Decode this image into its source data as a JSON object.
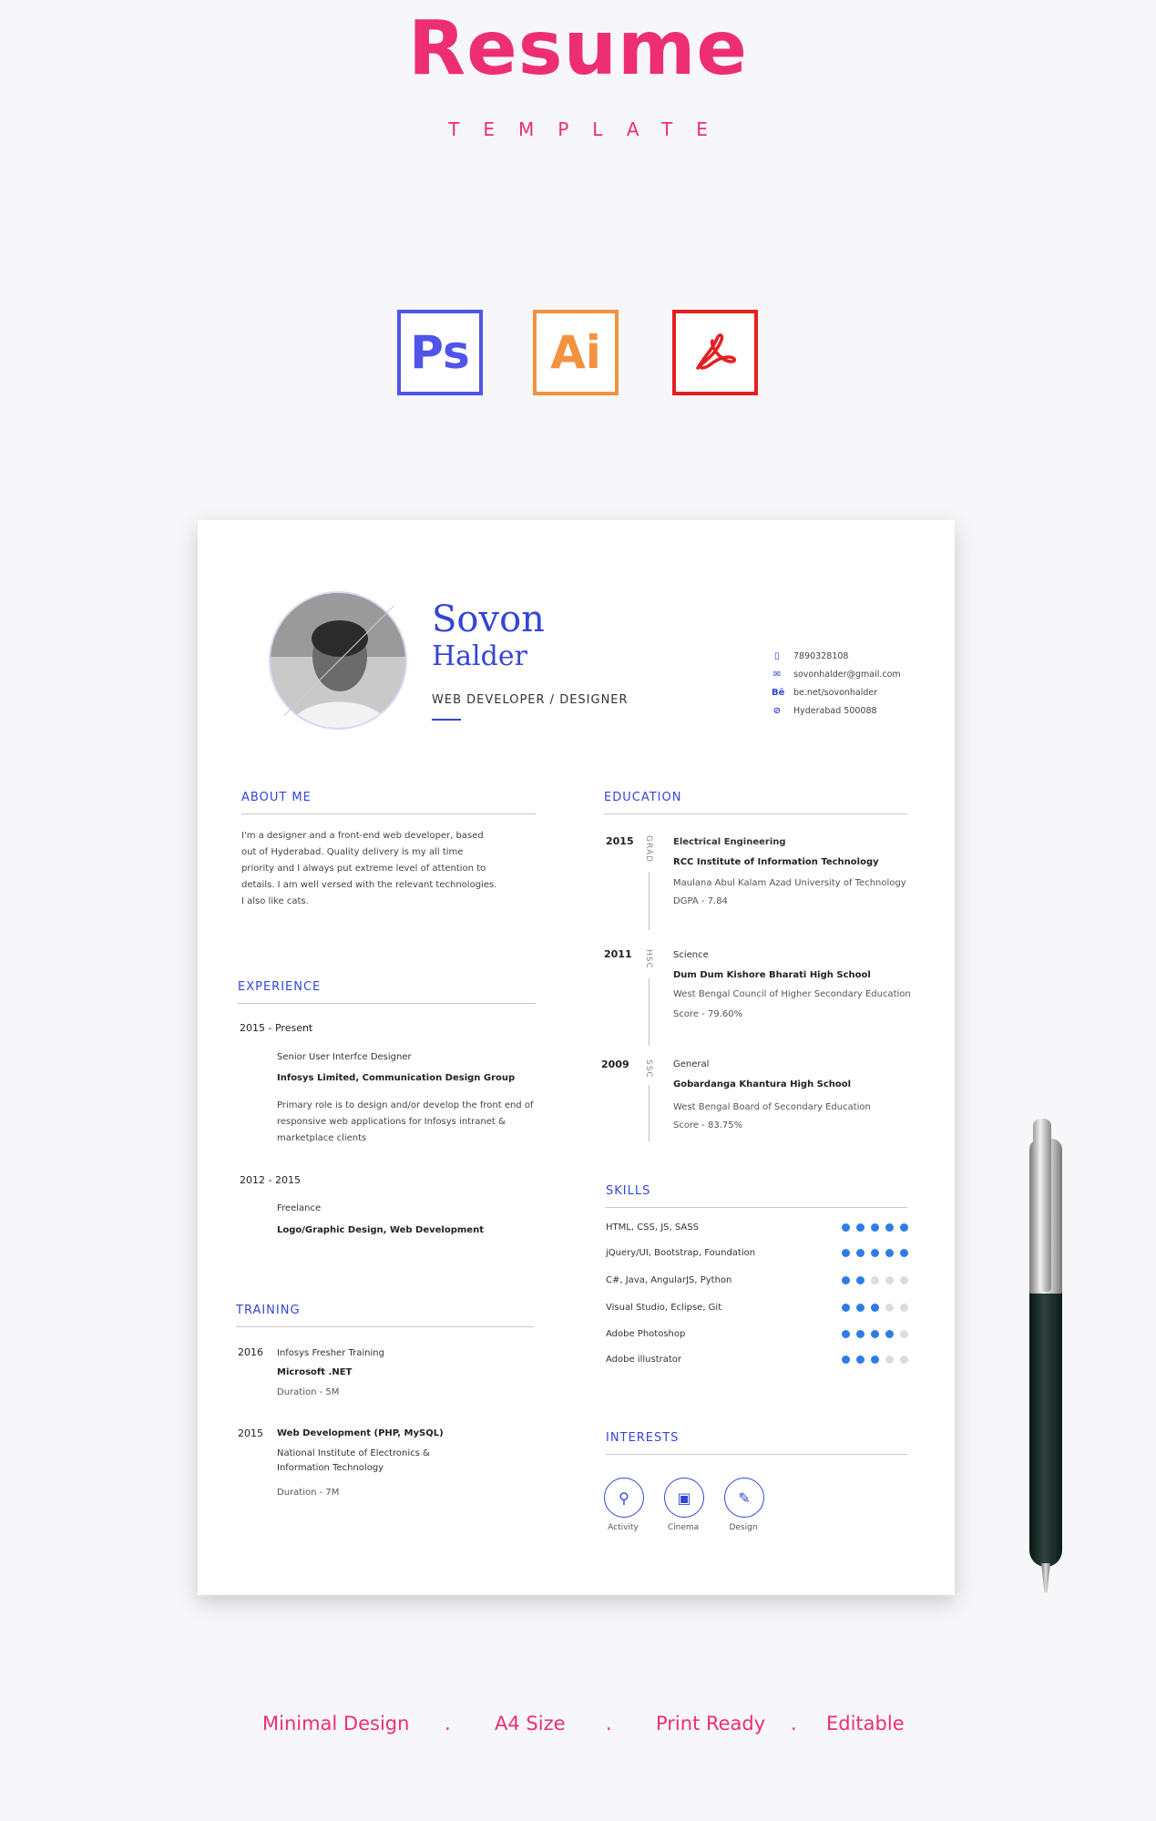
{
  "hero": {
    "title": "Resume",
    "subtitle": "TEMPLATE"
  },
  "apps": [
    {
      "label": "Ps",
      "color": "#4f55ea"
    },
    {
      "label": "Ai",
      "color": "#f39241"
    },
    {
      "label": "",
      "icon": "adobe-acrobat-icon",
      "color": "#e51f1f"
    }
  ],
  "resume": {
    "first_name": "Sovon",
    "last_name": "Halder",
    "role": "WEB DEVELOPER / DESIGNER",
    "contact": {
      "phone": "7890328108",
      "email": "sovonhalder@gmail.com",
      "behance": "be.net/sovonhalder",
      "location": "Hyderabad 500088"
    },
    "about": {
      "title": "ABOUT ME",
      "lines": [
        "I'm a designer and a front-end web developer, based",
        "out of Hyderabad. Quality delivery is my all time",
        "priority and I always put extreme level of attention to",
        "details. I am well versed with the relevant technologies.",
        "I also like cats."
      ]
    },
    "experience": {
      "title": "EXPERIENCE",
      "items": [
        {
          "period_start": "2015",
          "period_end": "Present",
          "role": "Senior User Interfce Designer",
          "company": "Infosys Limited, Communication Design Group",
          "desc": [
            "Primary role is to design and/or develop the front end of",
            "responsive web applications for Infosys intranet &",
            "marketplace clients"
          ]
        },
        {
          "period_start": "2012",
          "period_end": "2015",
          "role": "Freelance",
          "company": "Logo/Graphic Design, Web Development",
          "desc": []
        }
      ]
    },
    "training": {
      "title": "TRAINING",
      "items": [
        {
          "year": "2016",
          "name": "Infosys Fresher Training",
          "org": "Microsoft .NET",
          "duration": "Duration - 5M"
        },
        {
          "year": "2015",
          "name": "Web Development (PHP, MySQL)",
          "org": "National Institute of Electronics &",
          "org2": "Information Technology",
          "duration": "Duration - 7M"
        }
      ]
    },
    "education": {
      "title": "EDUCATION",
      "items": [
        {
          "year": "2015",
          "level": "GRAD",
          "field": "Electrical Engineering",
          "school": "RCC Institute of Information  Technology",
          "board": "Maulana Abul Kalam Azad University of Technology",
          "score": "DGPA - 7.84"
        },
        {
          "year": "2011",
          "level": "HSC",
          "field": "Science",
          "school": "Dum Dum Kishore Bharati High School",
          "board": "West Bengal Council of Higher Secondary Education",
          "score": "Score - 79.60%"
        },
        {
          "year": "2009",
          "level": "SSC",
          "field": "General",
          "school": "Gobardanga Khantura High School",
          "board": "West Bengal Board of Secondary Education",
          "score": "Score - 83.75%"
        }
      ]
    },
    "skills": {
      "title": "SKILLS",
      "items": [
        {
          "name": "HTML, CSS, JS, SASS",
          "level": 5
        },
        {
          "name": "jQuery/UI, Bootstrap, Foundation",
          "level": 5
        },
        {
          "name": "C#, Java, AngularJS, Python",
          "level": 2
        },
        {
          "name": "Visual Studio, Eclipse, Git",
          "level": 3
        },
        {
          "name": "Adobe Photoshop",
          "level": 4
        },
        {
          "name": "Adobe illustrator",
          "level": 3
        }
      ],
      "max": 5,
      "color": "#2f7ce6"
    },
    "interests": {
      "title": "INTERESTS",
      "items": [
        {
          "label": "Activity",
          "icon": "dumbbell-icon"
        },
        {
          "label": "Cinema",
          "icon": "camera-icon"
        },
        {
          "label": "Design",
          "icon": "pen-tool-icon"
        }
      ]
    }
  },
  "footer": [
    "Minimal Design",
    "A4 Size",
    "Print Ready",
    "Editable"
  ],
  "colors": {
    "accent": "#ee2e72",
    "resume_blue": "#3446d6"
  }
}
